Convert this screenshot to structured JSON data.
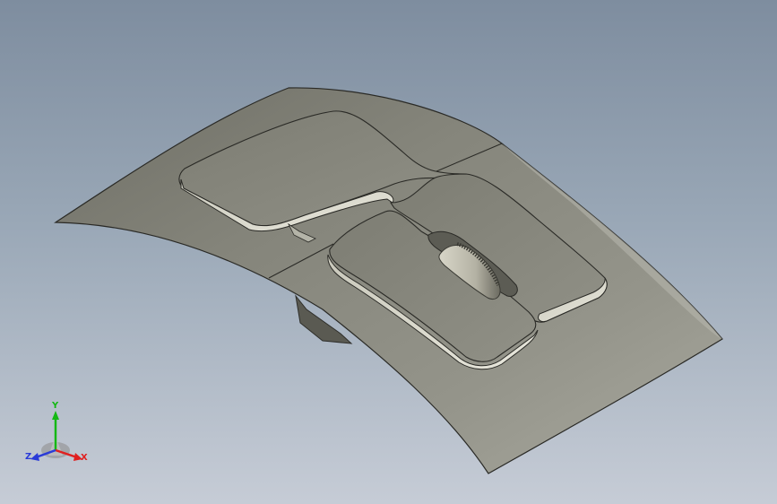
{
  "viewport": {
    "model_name": "mouse-top-shell",
    "background_top": "#7e8d9f",
    "background_bottom": "#c6ccd6",
    "part_color": "#8a8a7e"
  },
  "triad": {
    "x_label": "X",
    "y_label": "Y",
    "z_label": "Z",
    "x_color": "#e02020",
    "y_color": "#14b814",
    "z_color": "#2a3bd8"
  }
}
